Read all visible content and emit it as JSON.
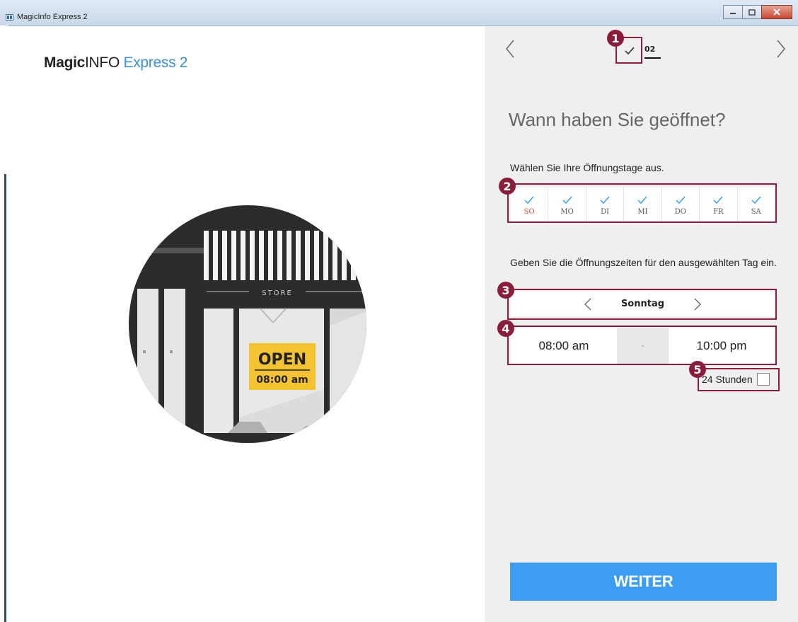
{
  "window": {
    "title": "MagicInfo Express 2"
  },
  "logo": {
    "part1": "Magic",
    "part2": "INFO",
    "part3": " Express 2"
  },
  "illustration": {
    "sign_word": "STORE",
    "open_label": "OPEN",
    "open_time": "08:00 am"
  },
  "stepper": {
    "current_step": "02"
  },
  "page": {
    "heading": "Wann haben Sie geöffnet?",
    "days_label": "Wählen Sie Ihre Öffnungstage aus.",
    "days": [
      {
        "label": "SO",
        "checked": true
      },
      {
        "label": "MO",
        "checked": true
      },
      {
        "label": "DI",
        "checked": true
      },
      {
        "label": "MI",
        "checked": true
      },
      {
        "label": "DO",
        "checked": true
      },
      {
        "label": "FR",
        "checked": true
      },
      {
        "label": "SA",
        "checked": true
      }
    ],
    "hours_label": "Geben Sie die Öffnungszeiten für den ausgewählten Tag ein.",
    "selected_day": "Sonntag",
    "open_time": "08:00 am",
    "separator": "-",
    "close_time": "10:00 pm",
    "hours24_label": "24 Stunden",
    "hours24_checked": false,
    "next_button": "WEITER"
  },
  "annotations": [
    "1",
    "2",
    "3",
    "4",
    "5"
  ],
  "colors": {
    "accent_blue": "#3d9df3",
    "annotation": "#8b1d3b",
    "sunday_red": "#d2473b",
    "panel_bg": "#efefef"
  }
}
